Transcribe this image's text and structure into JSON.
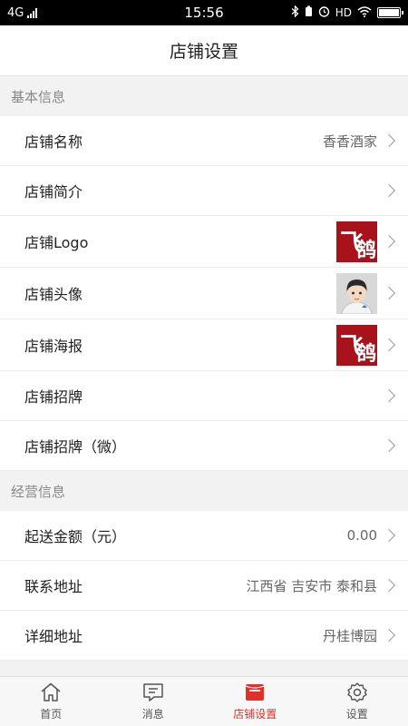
{
  "status_bar": {
    "network": "4G",
    "time": "15:56",
    "hd": "HD"
  },
  "header": {
    "title": "店铺设置"
  },
  "sections": [
    {
      "title": "基本信息",
      "rows": [
        {
          "label": "店铺名称",
          "value": "香香酒家"
        },
        {
          "label": "店铺简介",
          "value": ""
        },
        {
          "label": "店铺Logo",
          "thumb": "logo-image"
        },
        {
          "label": "店铺头像",
          "thumb": "avatar-image"
        },
        {
          "label": "店铺海报",
          "thumb": "poster-image"
        },
        {
          "label": "店铺招牌",
          "value": ""
        },
        {
          "label": "店铺招牌（微）",
          "value": ""
        }
      ]
    },
    {
      "title": "经营信息",
      "rows": [
        {
          "label": "起送金额（元）",
          "value": "0.00"
        },
        {
          "label": "联系地址",
          "value": "江西省 吉安市 泰和县"
        },
        {
          "label": "详细地址",
          "value": "丹桂博园"
        }
      ]
    }
  ],
  "tabbar": {
    "items": [
      {
        "label": "首页",
        "icon": "home-icon"
      },
      {
        "label": "消息",
        "icon": "message-icon"
      },
      {
        "label": "店铺设置",
        "icon": "store-icon",
        "active": true
      },
      {
        "label": "设置",
        "icon": "gear-icon"
      }
    ]
  },
  "colors": {
    "accent": "#e1302a",
    "logo_bg": "#a8121a",
    "section_bg": "#f2f2f2"
  }
}
